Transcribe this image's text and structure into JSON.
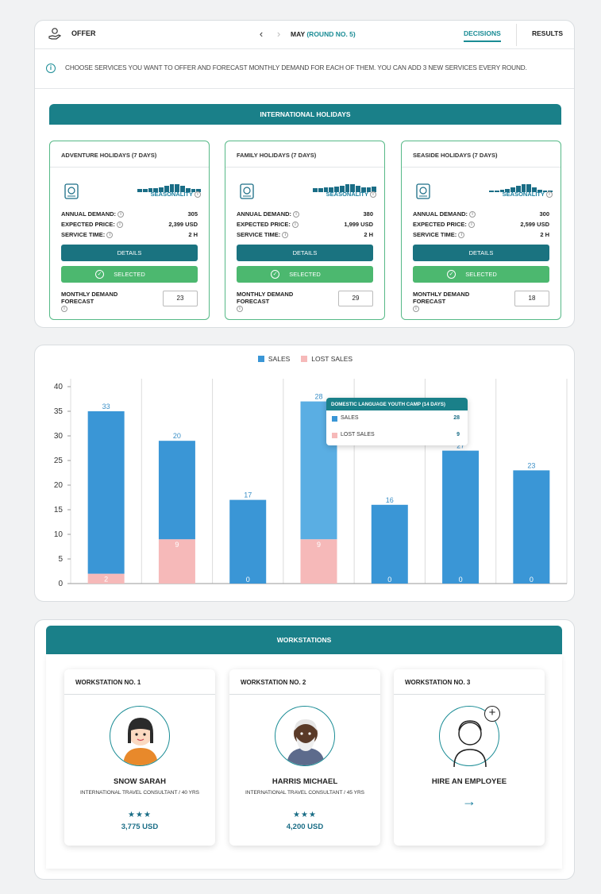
{
  "header": {
    "offer_label": "OFFER",
    "month": "MAY",
    "round": "(ROUND NO. 5)",
    "tab_decisions": "DECISIONS",
    "tab_results": "RESULTS"
  },
  "info": {
    "text": "CHOOSE SERVICES YOU WANT TO OFFER AND FORECAST MONTHLY DEMAND FOR EACH OF THEM. YOU CAN ADD 3 NEW SERVICES EVERY ROUND."
  },
  "category": {
    "title": "INTERNATIONAL HOLIDAYS"
  },
  "services": [
    {
      "title": "ADVENTURE HOLIDAYS (7 DAYS)",
      "seasonality_label": "SEASONALITY",
      "annual_demand_label": "ANNUAL DEMAND:",
      "annual_demand": "305",
      "expected_price_label": "EXPECTED PRICE:",
      "expected_price": "2,399 USD",
      "service_time_label": "SERVICE TIME:",
      "service_time": "2 H",
      "details_label": "DETAILS",
      "selected_label": "SELECTED",
      "forecast_label": "MONTHLY DEMAND FORECAST",
      "forecast_value": "23"
    },
    {
      "title": "FAMILY HOLIDAYS (7 DAYS)",
      "seasonality_label": "SEASONALITY",
      "annual_demand_label": "ANNUAL DEMAND:",
      "annual_demand": "380",
      "expected_price_label": "EXPECTED PRICE:",
      "expected_price": "1,999 USD",
      "service_time_label": "SERVICE TIME:",
      "service_time": "2 H",
      "details_label": "DETAILS",
      "selected_label": "SELECTED",
      "forecast_label": "MONTHLY DEMAND FORECAST",
      "forecast_value": "29"
    },
    {
      "title": "SEASIDE HOLIDAYS (7 DAYS)",
      "seasonality_label": "SEASONALITY",
      "annual_demand_label": "ANNUAL DEMAND:",
      "annual_demand": "300",
      "expected_price_label": "EXPECTED PRICE:",
      "expected_price": "2,599 USD",
      "service_time_label": "SERVICE TIME:",
      "service_time": "2 H",
      "details_label": "DETAILS",
      "selected_label": "SELECTED",
      "forecast_label": "MONTHLY DEMAND FORECAST",
      "forecast_value": "18"
    }
  ],
  "chart_data": {
    "type": "bar",
    "stacked": true,
    "legend": [
      "SALES",
      "LOST SALES"
    ],
    "legend_position": "top-center",
    "ylim": [
      0,
      40
    ],
    "yticks": [
      0,
      5,
      10,
      15,
      20,
      25,
      30,
      35,
      40
    ],
    "series": [
      {
        "name": "SALES",
        "color": "#3a96d6",
        "values": [
          33,
          20,
          17,
          28,
          16,
          27,
          23
        ]
      },
      {
        "name": "LOST SALES",
        "color": "#f6b9b9",
        "values": [
          2,
          9,
          0,
          9,
          0,
          0,
          0
        ]
      }
    ],
    "tooltip": {
      "title": "DOMESTIC LANGUAGE YOUTH CAMP (14 DAYS)",
      "rows": [
        {
          "label": "SALES",
          "value": "28"
        },
        {
          "label": "LOST SALES",
          "value": "9"
        }
      ]
    }
  },
  "workstations": {
    "title": "WORKSTATIONS",
    "items": [
      {
        "title": "WORKSTATION NO. 1",
        "name": "SNOW SARAH",
        "role": "INTERNATIONAL TRAVEL CONSULTANT / 40 YRS",
        "stars": "★★★",
        "salary": "3,775 USD"
      },
      {
        "title": "WORKSTATION NO. 2",
        "name": "HARRIS MICHAEL",
        "role": "INTERNATIONAL TRAVEL CONSULTANT / 45 YRS",
        "stars": "★★★",
        "salary": "4,200 USD"
      },
      {
        "title": "WORKSTATION NO. 3",
        "name": "HIRE AN EMPLOYEE",
        "arrow": "→"
      }
    ]
  }
}
